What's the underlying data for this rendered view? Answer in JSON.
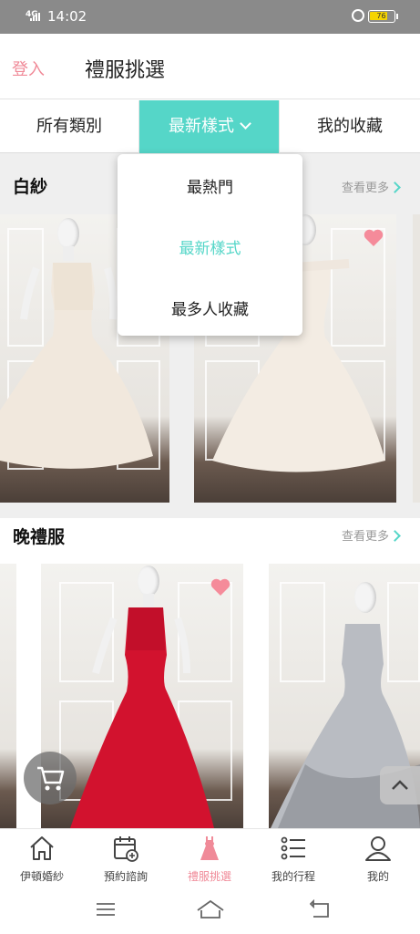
{
  "status_bar": {
    "network": "4G",
    "time": "14:02",
    "battery": "76",
    "battery_fraction": 0.76
  },
  "header": {
    "login": "登入",
    "title": "禮服挑選"
  },
  "tabs": [
    {
      "label": "所有類別"
    },
    {
      "label": "最新樣式"
    },
    {
      "label": "我的收藏"
    }
  ],
  "dropdown": {
    "options": [
      {
        "label": "最熱門"
      },
      {
        "label": "最新樣式"
      },
      {
        "label": "最多人收藏"
      }
    ],
    "selected": "最新樣式"
  },
  "sections": [
    {
      "title": "白紗",
      "more": "查看更多"
    },
    {
      "title": "晚禮服",
      "more": "查看更多"
    }
  ],
  "colors": {
    "accent": "#55d6c8",
    "pink": "#f08a98",
    "heart": "#f58b9a"
  },
  "icons": [
    "heart-icon",
    "cart-icon",
    "arrow-up-icon",
    "home-icon",
    "calendar-icon",
    "dress-icon",
    "list-icon",
    "user-icon"
  ],
  "bottom_nav": [
    {
      "label": "伊頓婚紗"
    },
    {
      "label": "預約諮詢"
    },
    {
      "label": "禮服挑選"
    },
    {
      "label": "我的行程"
    },
    {
      "label": "我的"
    }
  ]
}
